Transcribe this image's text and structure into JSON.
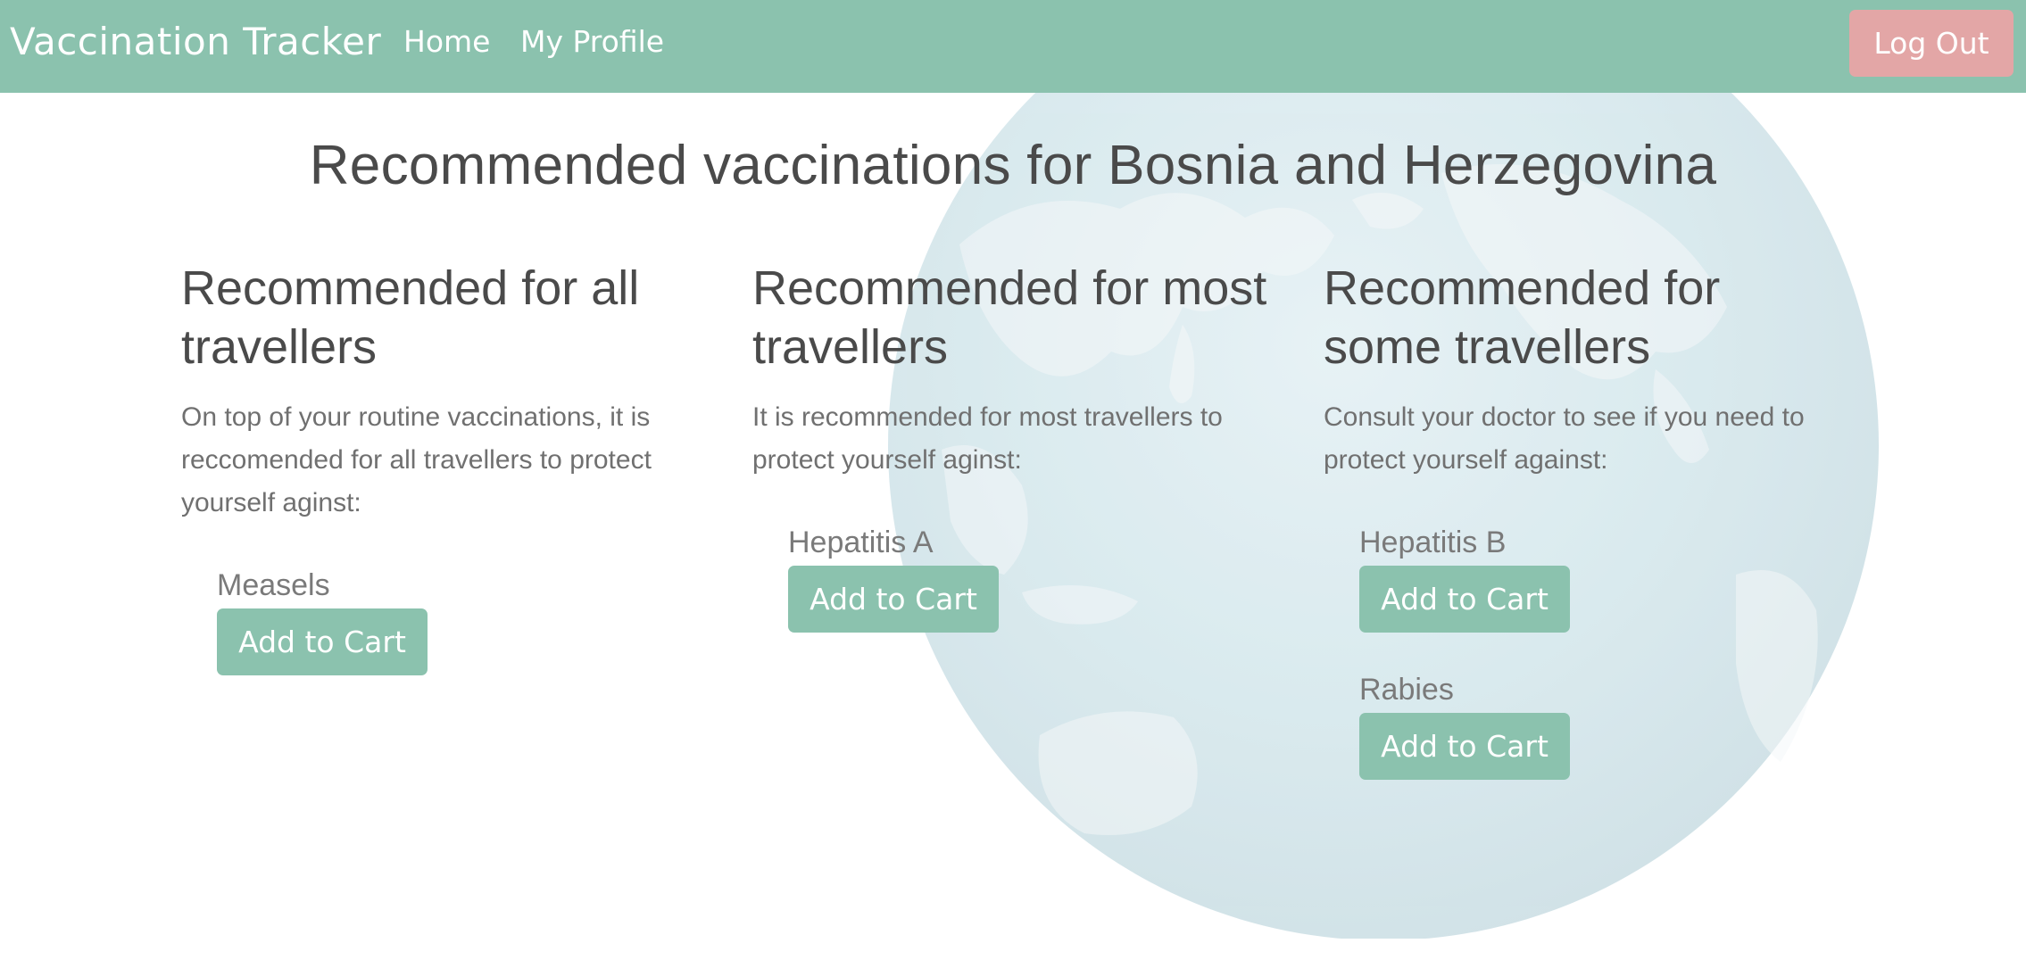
{
  "navbar": {
    "brand": "Vaccination Tracker",
    "links": [
      {
        "label": "Home"
      },
      {
        "label": "My Profile"
      }
    ],
    "logout_label": "Log Out"
  },
  "page": {
    "title": "Recommended vaccinations for Bosnia and Herzegovina"
  },
  "columns": [
    {
      "heading": "Recommended for all travellers",
      "description": "On top of your routine vaccinations, it is reccomended for all travellers to protect yourself aginst:",
      "vaccines": [
        {
          "name": "Measels",
          "button_label": "Add to Cart"
        }
      ]
    },
    {
      "heading": "Recommended for most travellers",
      "description": "It is recommended for most travellers to protect yourself aginst:",
      "vaccines": [
        {
          "name": "Hepatitis A",
          "button_label": "Add to Cart"
        }
      ]
    },
    {
      "heading": "Recommended for some travellers",
      "description": "Consult your doctor to see if you need to protect yourself against:",
      "vaccines": [
        {
          "name": "Hepatitis B",
          "button_label": "Add to Cart"
        },
        {
          "name": "Rabies",
          "button_label": "Add to Cart"
        }
      ]
    }
  ],
  "colors": {
    "primary": "#8bc2ae",
    "logout": "#e3a6a6",
    "heading_text": "#4a4a4a",
    "body_text": "#707070"
  },
  "background_image": "globe-image"
}
